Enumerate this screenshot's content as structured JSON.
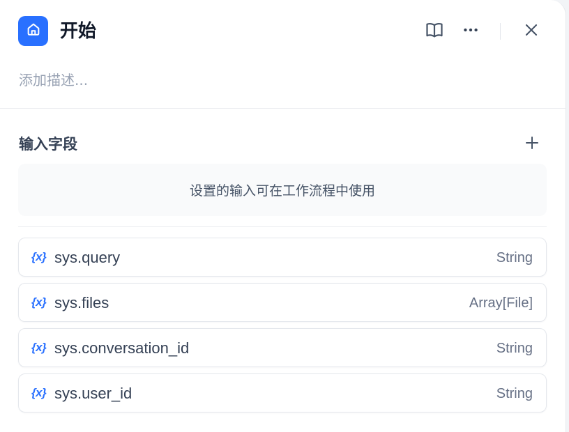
{
  "node": {
    "title": "开始",
    "description_placeholder": "添加描述...",
    "icon": "home-icon"
  },
  "header_actions": {
    "docs_icon": "book-open-icon",
    "more_icon": "more-horizontal-icon",
    "close_icon": "close-icon"
  },
  "input_fields": {
    "section_title": "输入字段",
    "add_icon": "plus-icon",
    "empty_hint": "设置的输入可在工作流程中使用"
  },
  "system_variables": [
    {
      "icon_text": "{x}",
      "name": "sys.query",
      "type": "String"
    },
    {
      "icon_text": "{x}",
      "name": "sys.files",
      "type": "Array[File]"
    },
    {
      "icon_text": "{x}",
      "name": "sys.conversation_id",
      "type": "String"
    },
    {
      "icon_text": "{x}",
      "name": "sys.user_id",
      "type": "String"
    }
  ],
  "colors": {
    "accent": "#2970ff",
    "text_primary": "#101828",
    "text_secondary": "#344054",
    "text_muted": "#98a2b3"
  }
}
